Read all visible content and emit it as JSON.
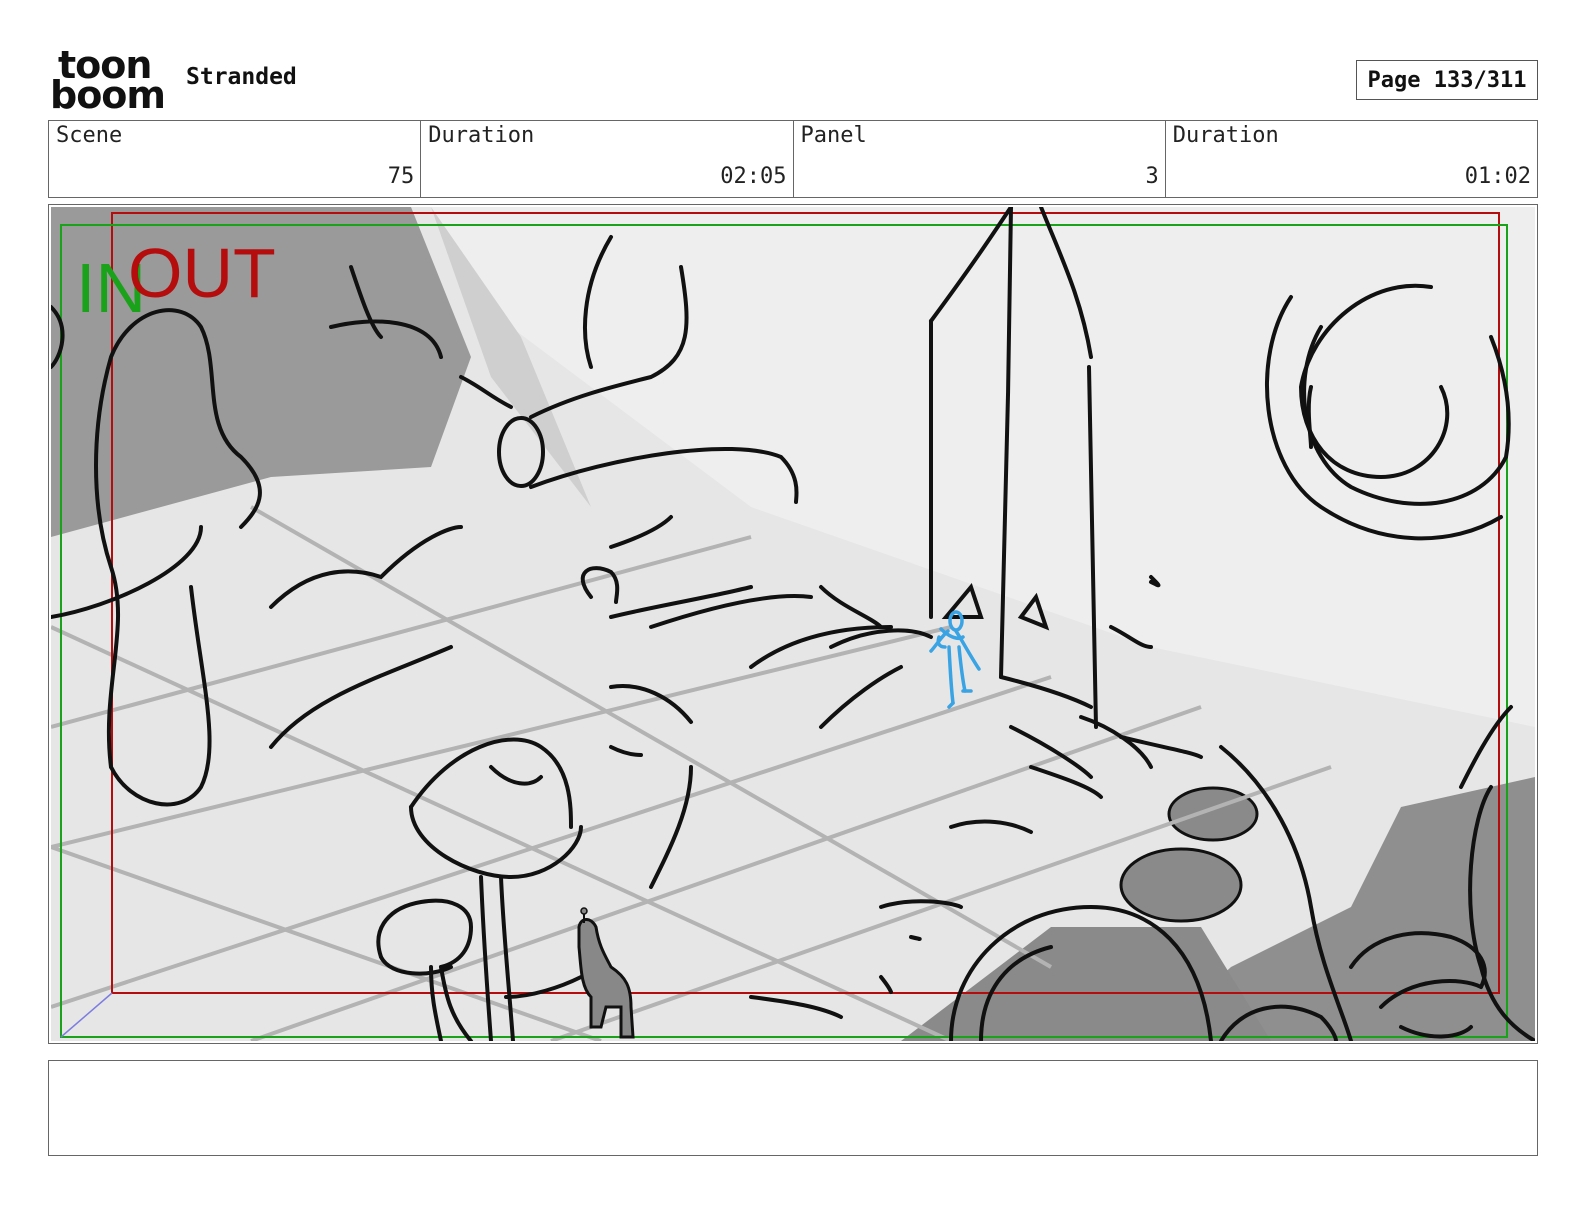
{
  "header": {
    "logo_text_top": "toon",
    "logo_text_bottom": "boom",
    "project_title": "Stranded",
    "page_label": "Page 133/311"
  },
  "info": {
    "scene_label": "Scene",
    "scene_value": "75",
    "scene_duration_label": "Duration",
    "scene_duration_value": "02:05",
    "panel_label": "Panel",
    "panel_value": "3",
    "panel_duration_label": "Duration",
    "panel_duration_value": "01:02"
  },
  "frame": {
    "in_label": "IN",
    "out_label": "OUT",
    "in_color": "#1aa21a",
    "out_color": "#b50d0d",
    "character_color": "#3aa3e3"
  },
  "notes": {
    "text": ""
  }
}
